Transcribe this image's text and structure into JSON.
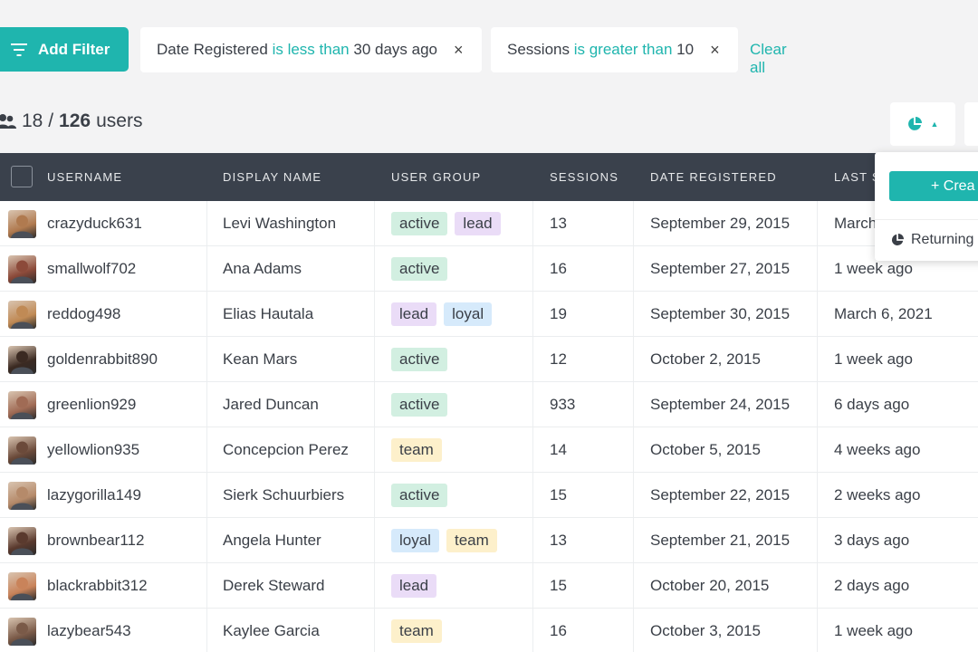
{
  "filters": {
    "add_label": "Add Filter",
    "chips": [
      {
        "field": "Date Registered",
        "op": "is less than",
        "value": "30 days ago",
        "close": "×"
      },
      {
        "field": "Sessions",
        "op": "is greater than",
        "value": "10",
        "close": "×"
      }
    ],
    "clear_all": "Clear all"
  },
  "count": {
    "shown": "18",
    "sep": "/",
    "total": "126",
    "unit": "users"
  },
  "table": {
    "headers": [
      "USERNAME",
      "DISPLAY NAME",
      "USER GROUP",
      "SESSIONS",
      "DATE REGISTERED",
      "LAST S"
    ],
    "rows": [
      {
        "username": "crazyduck631",
        "display": "Levi Washington",
        "tags": [
          "active",
          "lead"
        ],
        "sessions": "13",
        "date": "September 29, 2015",
        "last": "March",
        "avatar_color": "#b07a4f"
      },
      {
        "username": "smallwolf702",
        "display": "Ana Adams",
        "tags": [
          "active"
        ],
        "sessions": "16",
        "date": "September 27, 2015",
        "last": "1 week ago",
        "avatar_color": "#8c4a3a"
      },
      {
        "username": "reddog498",
        "display": "Elias Hautala",
        "tags": [
          "lead",
          "loyal"
        ],
        "sessions": "19",
        "date": "September 30, 2015",
        "last": "March 6, 2021",
        "avatar_color": "#c08a55"
      },
      {
        "username": "goldenrabbit890",
        "display": "Kean Mars",
        "tags": [
          "active"
        ],
        "sessions": "12",
        "date": "October 2, 2015",
        "last": "1 week ago",
        "avatar_color": "#3b2a22"
      },
      {
        "username": "greenlion929",
        "display": "Jared Duncan",
        "tags": [
          "active"
        ],
        "sessions": "933",
        "date": "September 24, 2015",
        "last": "6 days ago",
        "avatar_color": "#a06b55"
      },
      {
        "username": "yellowlion935",
        "display": "Concepcion Perez",
        "tags": [
          "team"
        ],
        "sessions": "14",
        "date": "October 5, 2015",
        "last": "4 weeks ago",
        "avatar_color": "#6b4a3a"
      },
      {
        "username": "lazygorilla149",
        "display": "Sierk Schuurbiers",
        "tags": [
          "active"
        ],
        "sessions": "15",
        "date": "September 22, 2015",
        "last": "2 weeks ago",
        "avatar_color": "#b58a6a"
      },
      {
        "username": "brownbear112",
        "display": "Angela Hunter",
        "tags": [
          "loyal",
          "team"
        ],
        "sessions": "13",
        "date": "September 21, 2015",
        "last": "3 days ago",
        "avatar_color": "#5a3a2e"
      },
      {
        "username": "blackrabbit312",
        "display": "Derek Steward",
        "tags": [
          "lead"
        ],
        "sessions": "15",
        "date": "October 20, 2015",
        "last": "2 days ago",
        "avatar_color": "#c9835a"
      },
      {
        "username": "lazybear543",
        "display": "Kaylee Garcia",
        "tags": [
          "team"
        ],
        "sessions": "16",
        "date": "October 3, 2015",
        "last": "1 week ago",
        "avatar_color": "#7a5a48"
      }
    ]
  },
  "segments": {
    "create_label": "+ Crea",
    "item_label": "Returning"
  },
  "colors": {
    "accent": "#1fb5ae",
    "header_bg": "#3a414c"
  }
}
